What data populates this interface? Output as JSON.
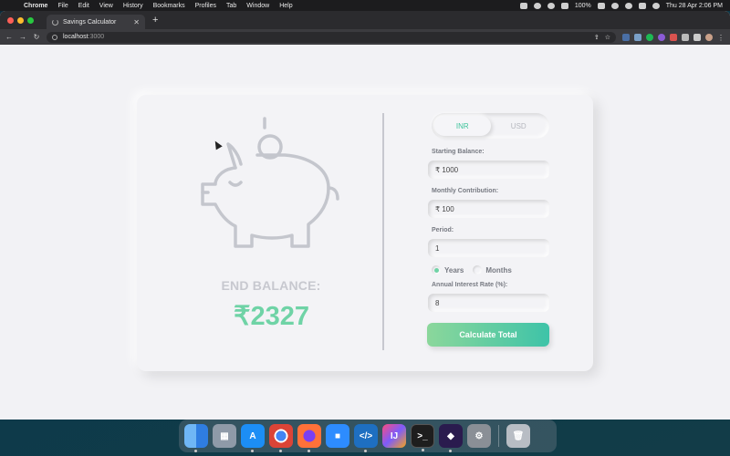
{
  "menubar": {
    "items": [
      "Chrome",
      "File",
      "Edit",
      "View",
      "History",
      "Bookmarks",
      "Profiles",
      "Tab",
      "Window",
      "Help"
    ],
    "battery": "100%",
    "datetime": "Thu 28 Apr  2:06 PM"
  },
  "browser": {
    "tab_title": "Savings Calculator",
    "url_host": "localhost",
    "url_port": ":3000"
  },
  "app": {
    "end_balance_label": "END BALANCE:",
    "end_balance_value": "₹2327",
    "currency_options": [
      "INR",
      "USD"
    ],
    "selected_currency": "INR",
    "starting_balance_label": "Starting Balance:",
    "starting_balance_value": "₹ 1000",
    "monthly_contribution_label": "Monthly Contribution:",
    "monthly_contribution_value": "₹ 100",
    "period_label": "Period:",
    "period_value": "1",
    "period_units": [
      "Years",
      "Months"
    ],
    "selected_period_unit": "Years",
    "interest_label": "Annual Interest Rate (%):",
    "interest_value": "8",
    "calculate_label": "Calculate Total"
  },
  "colors": {
    "accent": "#3ec39b",
    "accent_light": "#6fd3a6",
    "muted": "#c7c8cf"
  },
  "dock": {
    "apps": [
      "finder-icon",
      "launchpad-icon",
      "app-store-icon",
      "chrome-icon",
      "firefox-icon",
      "zoom-icon",
      "vscode-icon",
      "intellij-icon",
      "terminal-icon",
      "obsidian-icon",
      "system-preferences-icon",
      "trash-icon"
    ]
  }
}
